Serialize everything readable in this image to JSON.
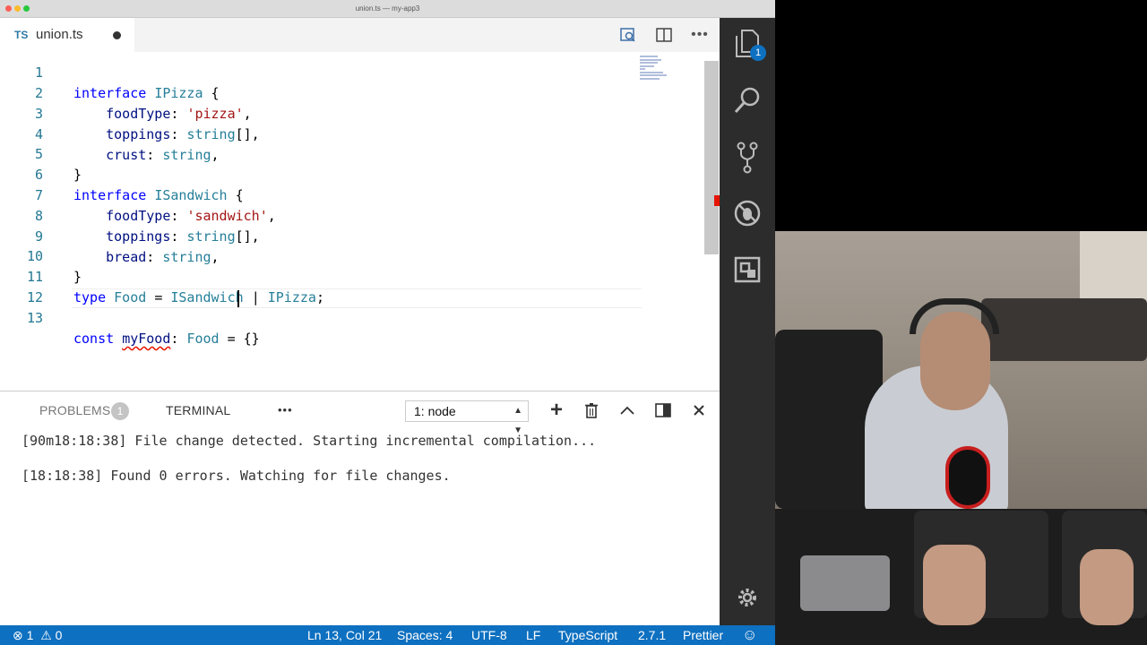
{
  "window": {
    "title": "union.ts — my-app3"
  },
  "editor_tab": {
    "lang_badge": "TS",
    "filename": "union.ts"
  },
  "editor_lines": [
    {
      "n": "1",
      "text": "interface IPizza {"
    },
    {
      "n": "2",
      "text": "foodType: 'pizza',"
    },
    {
      "n": "3",
      "text": "toppings: string[],"
    },
    {
      "n": "4",
      "text": "crust: string,"
    },
    {
      "n": "5",
      "text": "}"
    },
    {
      "n": "6",
      "text": "interface ISandwich {"
    },
    {
      "n": "7",
      "text": "foodType: 'sandwich',"
    },
    {
      "n": "8",
      "text": "toppings: string[],"
    },
    {
      "n": "9",
      "text": "bread: string,"
    },
    {
      "n": "10",
      "text": "}"
    },
    {
      "n": "11",
      "text": "type Food = ISandwich | IPizza;"
    },
    {
      "n": "12",
      "text": ""
    },
    {
      "n": "13",
      "text": "const myFood: Food = {}"
    }
  ],
  "panel": {
    "problems_label": "PROBLEMS",
    "problems_count": "1",
    "terminal_label": "TERMINAL",
    "more": "•••",
    "terminal_select": "1: node",
    "terminal_lines": [
      "[90m18:18:38] File change detected. Starting incremental compilation...",
      "[18:18:38] Found 0 errors. Watching for file changes."
    ]
  },
  "activity": {
    "explorer_badge": "1"
  },
  "statusbar": {
    "errors": "1",
    "warnings": "0",
    "position": "Ln 13, Col 21",
    "spaces": "Spaces: 4",
    "encoding": "UTF-8",
    "eol": "LF",
    "language": "TypeScript",
    "version": "2.7.1",
    "formatter": "Prettier",
    "feedback_icon": "smiley-icon"
  },
  "colors": {
    "statusbar": "#0e70c0",
    "activity_bar": "#2c2c2c",
    "keyword": "#0000ff",
    "type": "#267f99",
    "property": "#001080",
    "string": "#a31515",
    "line_number": "#237893"
  }
}
